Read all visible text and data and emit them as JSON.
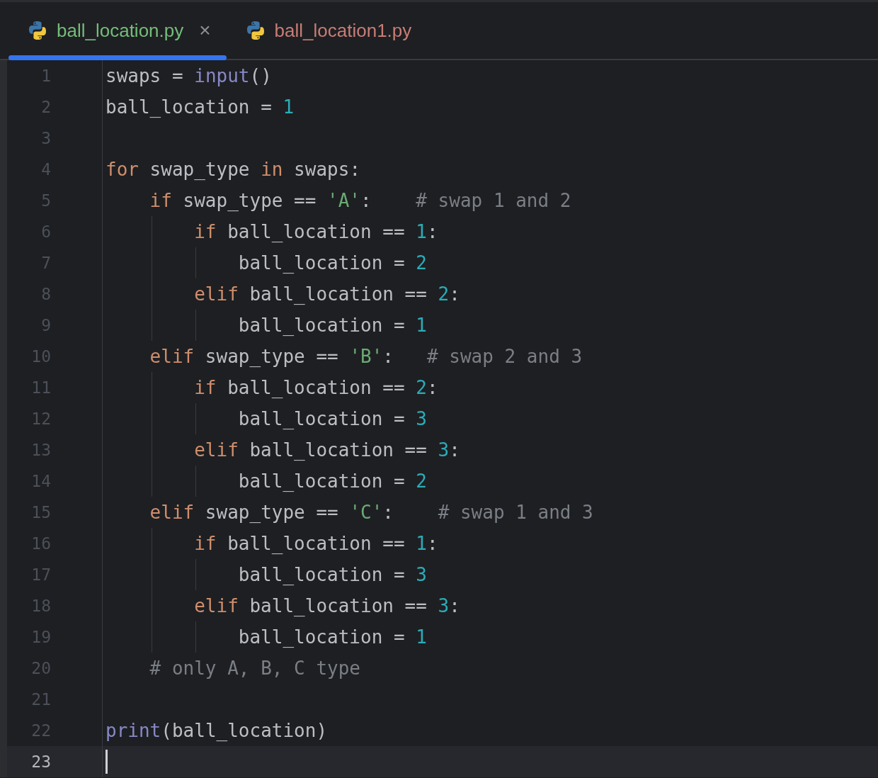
{
  "tabs": [
    {
      "label": "ball_location.py",
      "selected": true,
      "color": "#73bd79",
      "close_glyph": "×"
    },
    {
      "label": "ball_location1.py",
      "selected": false,
      "color": "#c77d75"
    }
  ],
  "editor": {
    "lines": [
      {
        "number": "1",
        "current": false,
        "tokens": [
          {
            "kind": "plain",
            "text": "swaps = "
          },
          {
            "kind": "builtin",
            "text": "input"
          },
          {
            "kind": "plain",
            "text": "()"
          }
        ]
      },
      {
        "number": "2",
        "current": false,
        "tokens": [
          {
            "kind": "plain",
            "text": "ball_location = "
          },
          {
            "kind": "number",
            "text": "1"
          }
        ]
      },
      {
        "number": "3",
        "current": false
      },
      {
        "number": "4",
        "current": false,
        "tokens": [
          {
            "kind": "keyword",
            "text": "for"
          },
          {
            "kind": "plain",
            "text": " swap_type "
          },
          {
            "kind": "keyword",
            "text": "in"
          },
          {
            "kind": "plain",
            "text": " swaps:"
          }
        ],
        "children": [
          {
            "number": "5",
            "current": false,
            "tokens": [
              {
                "kind": "keyword",
                "text": "if"
              },
              {
                "kind": "plain",
                "text": " swap_type == "
              },
              {
                "kind": "string",
                "text": "'A'"
              },
              {
                "kind": "plain",
                "text": ":    "
              },
              {
                "kind": "comment",
                "text": "# swap 1 and 2"
              }
            ],
            "children": [
              {
                "number": "6",
                "current": false,
                "tokens": [
                  {
                    "kind": "keyword",
                    "text": "if"
                  },
                  {
                    "kind": "plain",
                    "text": " ball_location == "
                  },
                  {
                    "kind": "number",
                    "text": "1"
                  },
                  {
                    "kind": "plain",
                    "text": ":"
                  }
                ],
                "children": [
                  {
                    "number": "7",
                    "current": false,
                    "tokens": [
                      {
                        "kind": "plain",
                        "text": "ball_location = "
                      },
                      {
                        "kind": "number",
                        "text": "2"
                      }
                    ]
                  }
                ]
              },
              {
                "number": "8",
                "current": false,
                "tokens": [
                  {
                    "kind": "keyword",
                    "text": "elif"
                  },
                  {
                    "kind": "plain",
                    "text": " ball_location == "
                  },
                  {
                    "kind": "number",
                    "text": "2"
                  },
                  {
                    "kind": "plain",
                    "text": ":"
                  }
                ],
                "children": [
                  {
                    "number": "9",
                    "current": false,
                    "tokens": [
                      {
                        "kind": "plain",
                        "text": "ball_location = "
                      },
                      {
                        "kind": "number",
                        "text": "1"
                      }
                    ]
                  }
                ]
              }
            ]
          },
          {
            "number": "10",
            "current": false,
            "tokens": [
              {
                "kind": "keyword",
                "text": "elif"
              },
              {
                "kind": "plain",
                "text": " swap_type == "
              },
              {
                "kind": "string",
                "text": "'B'"
              },
              {
                "kind": "plain",
                "text": ":   "
              },
              {
                "kind": "comment",
                "text": "# swap 2 and 3"
              }
            ],
            "children": [
              {
                "number": "11",
                "current": false,
                "tokens": [
                  {
                    "kind": "keyword",
                    "text": "if"
                  },
                  {
                    "kind": "plain",
                    "text": " ball_location == "
                  },
                  {
                    "kind": "number",
                    "text": "2"
                  },
                  {
                    "kind": "plain",
                    "text": ":"
                  }
                ],
                "children": [
                  {
                    "number": "12",
                    "current": false,
                    "tokens": [
                      {
                        "kind": "plain",
                        "text": "ball_location = "
                      },
                      {
                        "kind": "number",
                        "text": "3"
                      }
                    ]
                  }
                ]
              },
              {
                "number": "13",
                "current": false,
                "tokens": [
                  {
                    "kind": "keyword",
                    "text": "elif"
                  },
                  {
                    "kind": "plain",
                    "text": " ball_location == "
                  },
                  {
                    "kind": "number",
                    "text": "3"
                  },
                  {
                    "kind": "plain",
                    "text": ":"
                  }
                ],
                "children": [
                  {
                    "number": "14",
                    "current": false,
                    "tokens": [
                      {
                        "kind": "plain",
                        "text": "ball_location = "
                      },
                      {
                        "kind": "number",
                        "text": "2"
                      }
                    ]
                  }
                ]
              }
            ]
          },
          {
            "number": "15",
            "current": false,
            "tokens": [
              {
                "kind": "keyword",
                "text": "elif"
              },
              {
                "kind": "plain",
                "text": " swap_type == "
              },
              {
                "kind": "string",
                "text": "'C'"
              },
              {
                "kind": "plain",
                "text": ":    "
              },
              {
                "kind": "comment",
                "text": "# swap 1 and 3"
              }
            ],
            "children": [
              {
                "number": "16",
                "current": false,
                "tokens": [
                  {
                    "kind": "keyword",
                    "text": "if"
                  },
                  {
                    "kind": "plain",
                    "text": " ball_location == "
                  },
                  {
                    "kind": "number",
                    "text": "1"
                  },
                  {
                    "kind": "plain",
                    "text": ":"
                  }
                ],
                "children": [
                  {
                    "number": "17",
                    "current": false,
                    "tokens": [
                      {
                        "kind": "plain",
                        "text": "ball_location = "
                      },
                      {
                        "kind": "number",
                        "text": "3"
                      }
                    ]
                  }
                ]
              },
              {
                "number": "18",
                "current": false,
                "tokens": [
                  {
                    "kind": "keyword",
                    "text": "elif"
                  },
                  {
                    "kind": "plain",
                    "text": " ball_location == "
                  },
                  {
                    "kind": "number",
                    "text": "3"
                  },
                  {
                    "kind": "plain",
                    "text": ":"
                  }
                ],
                "children": [
                  {
                    "number": "19",
                    "current": false,
                    "tokens": [
                      {
                        "kind": "plain",
                        "text": "ball_location = "
                      },
                      {
                        "kind": "number",
                        "text": "1"
                      }
                    ]
                  }
                ]
              }
            ]
          },
          {
            "number": "20",
            "current": false,
            "tokens": [
              {
                "kind": "comment",
                "text": "# only A, B, C type"
              }
            ]
          }
        ]
      },
      {
        "number": "21",
        "current": false
      },
      {
        "number": "22",
        "current": false,
        "tokens": [
          {
            "kind": "builtin",
            "text": "print"
          },
          {
            "kind": "plain",
            "text": "(ball_location)"
          }
        ]
      },
      {
        "number": "23",
        "current": true
      }
    ]
  }
}
